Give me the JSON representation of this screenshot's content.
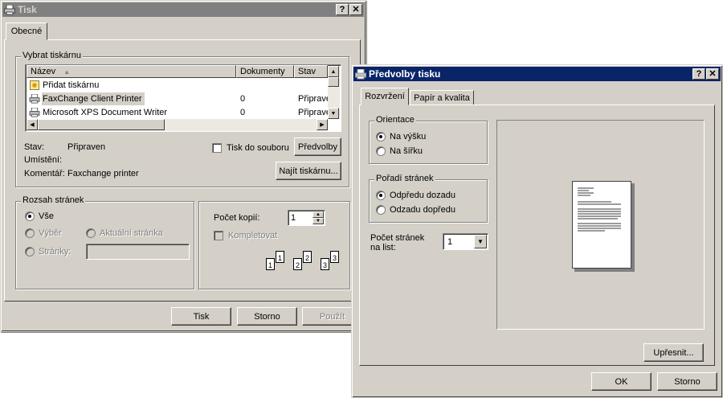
{
  "print_dialog": {
    "title": "Tisk",
    "help_button": "?",
    "close_button": "✕",
    "tab_general": "Obecné",
    "select_printer_group": "Vybrat tiskárnu",
    "columns": {
      "name": "Název",
      "documents": "Dokumenty",
      "status": "Stav"
    },
    "printers": [
      {
        "name": "Přidat tiskárnu",
        "documents": "",
        "status": ""
      },
      {
        "name": "FaxChange Client Printer",
        "documents": "0",
        "status": "Připrave"
      },
      {
        "name": "Microsoft XPS Document Writer",
        "documents": "0",
        "status": "Připrave"
      }
    ],
    "status_label": "Stav:",
    "status_value": "Připraven",
    "location_label": "Umístění:",
    "location_value": "",
    "comment_label": "Komentář:",
    "comment_value": "Faxchange printer",
    "print_to_file": "Tisk do souboru",
    "preferences_button": "Předvolby",
    "find_printer_button": "Najít tiskárnu...",
    "page_range_group": "Rozsah stránek",
    "range_all": "Vše",
    "range_selection": "Výběr",
    "range_current": "Aktuální stránka",
    "range_pages": "Stránky:",
    "pages_value": "",
    "copies_label": "Počet kopií:",
    "copies_value": "1",
    "collate": "Kompletovat",
    "collate_pages": [
      "1",
      "1",
      "2",
      "2",
      "3",
      "3"
    ],
    "print_button": "Tisk",
    "cancel_button": "Storno",
    "apply_button": "Použít"
  },
  "preferences_dialog": {
    "title": "Předvolby tisku",
    "help_button": "?",
    "close_button": "✕",
    "tab_layout": "Rozvržení",
    "tab_paper_quality": "Papír a kvalita",
    "orientation_group": "Orientace",
    "portrait": "Na výšku",
    "landscape": "Na šířku",
    "page_order_group": "Pořadí stránek",
    "front_to_back": "Odpředu dozadu",
    "back_to_front": "Odzadu dopředu",
    "pages_per_sheet_label": "Počet stránek na list:",
    "pages_per_sheet_value": "1",
    "advanced_button": "Upřesnit...",
    "ok_button": "OK",
    "cancel_button": "Storno"
  },
  "colors": {
    "face": "#d4d0c8",
    "active_title": "#0a246a",
    "inactive_title": "#808080",
    "selection": "#d4d0c8"
  }
}
